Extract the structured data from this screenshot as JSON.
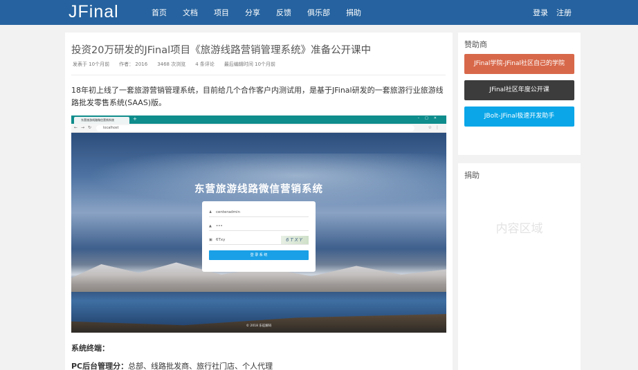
{
  "header": {
    "logo": "JFinal",
    "nav": [
      "首页",
      "文档",
      "项目",
      "分享",
      "反馈",
      "俱乐部",
      "捐助"
    ],
    "login": "登录",
    "register": "注册"
  },
  "post": {
    "title": "投资20万研发的JFinal项目《旅游线路营销管理系统》准备公开课中",
    "meta": {
      "published": "发表于 10个月前",
      "author": "作者： 2016",
      "views": "3468 次浏览",
      "comments": "4 条评论",
      "edited": "最后编辑时间 10个月前"
    },
    "intro": "18年初上线了一套旅游营销管理系统，目前给几个合作客户内测试用，是基于JFinal研发的一套旅游行业旅游线路批发零售系统(SAAS)版。",
    "screenshot": {
      "tab_title": "东营旅游线路微信营销系统",
      "url": "localhost",
      "system_title": "东营旅游线路微信营销系统",
      "username": "centeradmin",
      "password": "•••",
      "captcha_input": "6Txy",
      "captcha_image": "6TXY",
      "login_button": "登 录 系 统",
      "copyright": "© 2018 东征解码"
    },
    "section_title": "系统终端：",
    "pc_label": "PC后台管理分：",
    "pc_text": "总部、线路批发商、旅行社门店、个人代理"
  },
  "sidebar": {
    "sponsors_title": "赞助商",
    "sponsors": [
      {
        "label": "JFinal学院-JFinal社区自己的学院",
        "color": "#d8684a"
      },
      {
        "label": "JFinal社区年度公开课",
        "color": "#3c3c3c"
      },
      {
        "label": "JBolt-JFinal极速开发助手",
        "color": "#0aa6e8"
      }
    ],
    "donate_title": "捐助",
    "content_placeholder": "内容区域"
  }
}
